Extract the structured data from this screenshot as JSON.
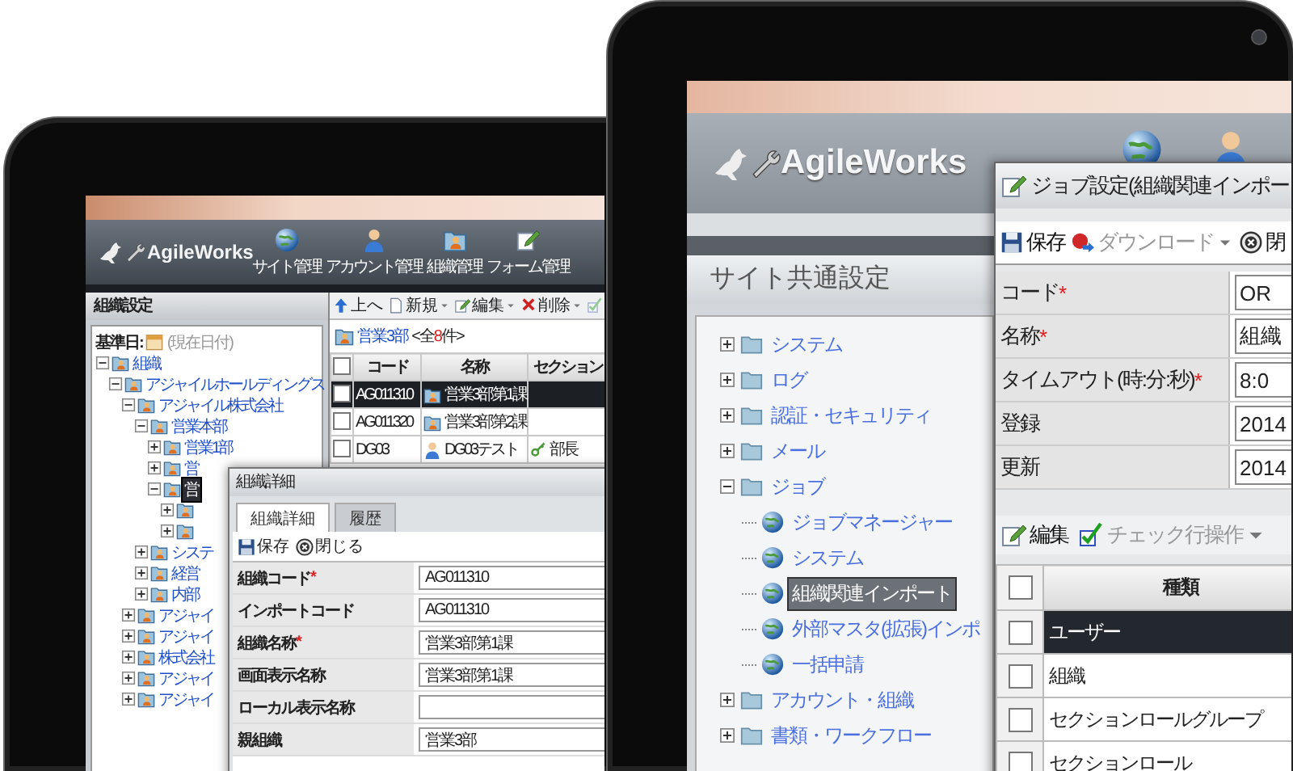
{
  "left_tablet": {
    "header": {
      "logo": "AgileWorks",
      "nav": [
        {
          "label": "サイト管理"
        },
        {
          "label": "アカウント管理"
        },
        {
          "label": "組織管理"
        },
        {
          "label": "フォーム管理"
        }
      ]
    },
    "sidebar": {
      "title": "組織設定",
      "base_date_label": "基準日:",
      "base_date_value": "(現在日付)",
      "tree": [
        {
          "label": "組織",
          "expanded": true,
          "selected": false,
          "children": [
            {
              "label": "アジャイルホールディングス",
              "expanded": true,
              "selected": false,
              "children": [
                {
                  "label": "アジャイル株式会社",
                  "expanded": true,
                  "selected": false,
                  "children": [
                    {
                      "label": "営業本部",
                      "expanded": true,
                      "selected": false,
                      "children": [
                        {
                          "label": "営業1部",
                          "expanded": false,
                          "selected": false
                        },
                        {
                          "label": "営",
                          "expanded": false,
                          "selected": false
                        },
                        {
                          "label": "営",
                          "expanded": true,
                          "selected": true,
                          "children": [
                            {
                              "expanded": false,
                              "selected": false
                            },
                            {
                              "expanded": false,
                              "selected": false
                            }
                          ]
                        }
                      ]
                    },
                    {
                      "label": "システ",
                      "expanded": false,
                      "selected": false
                    },
                    {
                      "label": "経営",
                      "expanded": false,
                      "selected": false
                    },
                    {
                      "label": "内部",
                      "expanded": false,
                      "selected": false
                    }
                  ]
                },
                {
                  "label": "アジャイ",
                  "expanded": false,
                  "selected": false
                },
                {
                  "label": "アジャイ",
                  "expanded": false,
                  "selected": false
                },
                {
                  "label": "株式会社",
                  "expanded": false,
                  "selected": false
                },
                {
                  "label": "アジャイ",
                  "expanded": false,
                  "selected": false
                },
                {
                  "label": "アジャイ",
                  "expanded": false,
                  "selected": false
                }
              ]
            }
          ]
        }
      ]
    },
    "toolbar": [
      {
        "label": "上へ",
        "menu": false,
        "disabled": false
      },
      {
        "label": "新規",
        "menu": true,
        "disabled": false
      },
      {
        "label": "編集",
        "menu": true,
        "disabled": false
      },
      {
        "label": "削除",
        "menu": true,
        "disabled": false
      },
      {
        "menu": false,
        "disabled": true
      }
    ],
    "breadcrumb": {
      "label": "営業3部",
      "count_prefix": "<全",
      "count": "8",
      "count_suffix": "件>"
    },
    "table": {
      "columns": [
        "コード",
        "名称",
        "セクション"
      ],
      "header_checked": false,
      "rows": [
        {
          "kind": "organization",
          "selected": true,
          "checked": false,
          "code": "AG011310",
          "name": "営業3部第1課"
        },
        {
          "kind": "organization",
          "selected": false,
          "checked": false,
          "code": "AG011320",
          "name": "営業3部第2課"
        },
        {
          "kind": "user",
          "selected": false,
          "checked": false,
          "code": "DG03",
          "name": "DG03テスト",
          "section": "部長"
        }
      ]
    },
    "dialog": {
      "title": "組織詳細",
      "tabs": [
        {
          "label": "組織詳細",
          "selected": true
        },
        {
          "label": "履歴",
          "selected": false
        }
      ],
      "toolbar": [
        {
          "label": "保存"
        },
        {
          "label": "閉じる"
        }
      ],
      "fields": [
        {
          "label": "組織コード",
          "mark": "*",
          "value": "AG011310"
        },
        {
          "label": "インポートコード",
          "value": "AG011310"
        },
        {
          "label": "組織名称",
          "mark": "*",
          "value": "営業3部第1課"
        },
        {
          "label": "画面表示名称",
          "value": "営業3部第1課"
        },
        {
          "label": "ローカル表示名称"
        },
        {
          "label": "親組織",
          "value": "営業3部"
        }
      ]
    }
  },
  "right_tablet": {
    "header": {
      "logo": "AgileWorks"
    },
    "sidebar": {
      "title": "サイト共通設定",
      "tree": [
        {
          "label": "システム",
          "expanded": false,
          "selected": false
        },
        {
          "label": "ログ",
          "expanded": false,
          "selected": false
        },
        {
          "label": "認証・セキュリティ",
          "expanded": false,
          "selected": false
        },
        {
          "label": "メール",
          "expanded": false,
          "selected": false
        },
        {
          "label": "ジョブ",
          "expanded": true,
          "selected": false,
          "children": [
            {
              "label": "ジョブマネージャー",
              "selected": false
            },
            {
              "label": "システム",
              "selected": false
            },
            {
              "label": "組織関連インポート",
              "selected": true
            },
            {
              "label": "外部マスタ(拡張)インポ",
              "selected": false
            },
            {
              "label": "一括申請",
              "selected": false
            }
          ]
        },
        {
          "label": "アカウント・組織",
          "expanded": false,
          "selected": false
        },
        {
          "label": "書類・ワークフロー",
          "expanded": false,
          "selected": false
        }
      ]
    },
    "dialog": {
      "title": "ジョブ設定(組織関連インポー",
      "toolbar": [
        {
          "label": "保存",
          "menu": false,
          "disabled": false
        },
        {
          "label": "ダウンロード",
          "menu": true,
          "disabled": true
        },
        {
          "label": "閉",
          "menu": false,
          "disabled": false
        }
      ],
      "fields": [
        {
          "label": "コード",
          "mark": "*",
          "value": "OR"
        },
        {
          "label": "名称",
          "mark": "*",
          "value": "組織"
        },
        {
          "label": "タイムアウト(時:分:秒)",
          "mark": "*",
          "value": "8:0"
        },
        {
          "label": "登録",
          "value": "2014"
        },
        {
          "label": "更新",
          "value": "2014"
        }
      ],
      "list_toolbar": [
        {
          "label": "編集",
          "menu": false,
          "disabled": false
        },
        {
          "label": "チェック行操作",
          "menu": true,
          "disabled": true
        }
      ],
      "table": {
        "columns": [
          "種類"
        ],
        "header_checked": false,
        "rows": [
          {
            "type": "ユーザー",
            "selected": true,
            "checked": false
          },
          {
            "type": "組織",
            "selected": false,
            "checked": false
          },
          {
            "type": "セクションロールグループ",
            "selected": false,
            "checked": false
          },
          {
            "type": "セクションロール",
            "selected": false,
            "checked": false
          }
        ]
      }
    }
  }
}
